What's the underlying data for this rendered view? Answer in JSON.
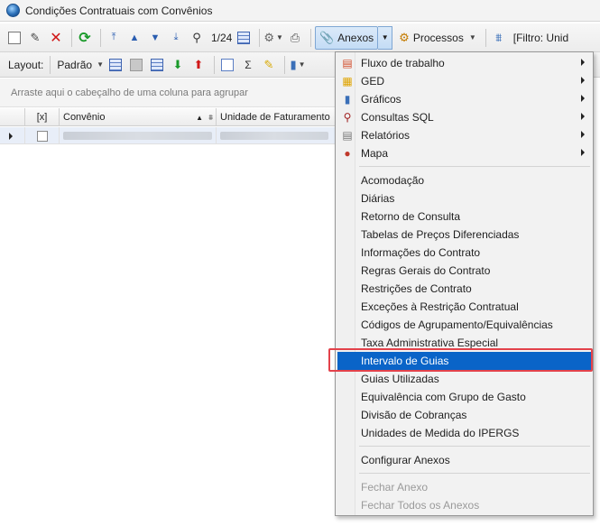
{
  "window": {
    "title": "Condições Contratuais com Convênios"
  },
  "toolbar": {
    "record_position": "1/24",
    "anexos_label": "Anexos",
    "processos_label": "Processos",
    "filtro_label": "[Filtro: Unid"
  },
  "toolbar2": {
    "layout_label": "Layout:",
    "padrao_label": "Padrão"
  },
  "grid": {
    "group_hint": "Arraste aqui o cabeçalho de uma coluna para agrupar",
    "columns": [
      "[x]",
      "Convênio",
      "Unidade de Faturamento"
    ]
  },
  "menu": {
    "submenus": [
      {
        "label": "Fluxo de trabalho",
        "icon": "workflow-icon"
      },
      {
        "label": "GED",
        "icon": "ged-icon"
      },
      {
        "label": "Gráficos",
        "icon": "chart-icon"
      },
      {
        "label": "Consultas SQL",
        "icon": "sql-query-icon"
      },
      {
        "label": "Relatórios",
        "icon": "report-icon"
      },
      {
        "label": "Mapa",
        "icon": "map-pin-icon"
      }
    ],
    "items": [
      "Acomodação",
      "Diárias",
      "Retorno de Consulta",
      "Tabelas de Preços Diferenciadas",
      "Informações do Contrato",
      "Regras Gerais do Contrato",
      "Restrições de Contrato",
      "Exceções à Restrição Contratual",
      "Códigos de Agrupamento/Equivalências",
      "Taxa Administrativa Especial",
      "Intervalo de Guias",
      "Guias Utilizadas",
      "Equivalência com Grupo de Gasto",
      "Divisão de Cobranças",
      "Unidades de Medida do IPERGS"
    ],
    "configure": "Configurar Anexos",
    "close_items": [
      "Fechar Anexo",
      "Fechar Todos os Anexos"
    ]
  },
  "colors": {
    "selection": "#0a64c8",
    "highlight_border": "#e3424b"
  }
}
